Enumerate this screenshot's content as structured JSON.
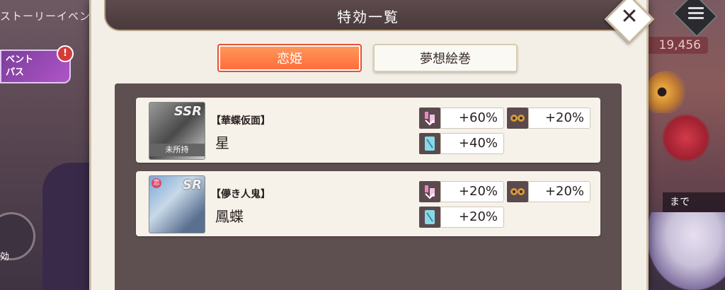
{
  "background": {
    "top_text": "ストーリーイベント",
    "event_banner": "ベント\nパス",
    "event_badge": "!",
    "coin_value": "19,456",
    "made_text": "まで",
    "left_small_text": "効"
  },
  "modal": {
    "title": "特効一覧",
    "close_label": "✕",
    "tabs": [
      {
        "label": "恋姫",
        "active": true
      },
      {
        "label": "夢想絵巻",
        "active": false
      }
    ]
  },
  "cards": [
    {
      "title": "【華蝶仮面】",
      "name": "星",
      "rarity": "SSR",
      "status_label": "未所持",
      "bonuses": [
        {
          "icon": "key-icon",
          "value": "+60%"
        },
        {
          "icon": "mask-icon",
          "value": "+20%"
        },
        {
          "icon": "ticket-icon",
          "value": "+40%"
        }
      ]
    },
    {
      "title": "【儚き人鬼】",
      "name": "鳳蝶",
      "rarity": "SR",
      "badge": "恋",
      "bonuses": [
        {
          "icon": "key-icon",
          "value": "+20%"
        },
        {
          "icon": "mask-icon",
          "value": "+20%"
        },
        {
          "icon": "ticket-icon",
          "value": "+20%"
        }
      ]
    }
  ],
  "colors": {
    "tab_active": "#ff7a45",
    "panel": "#5e4f50",
    "header": "#4f3e40",
    "card_bg": "#f6f2ea"
  }
}
